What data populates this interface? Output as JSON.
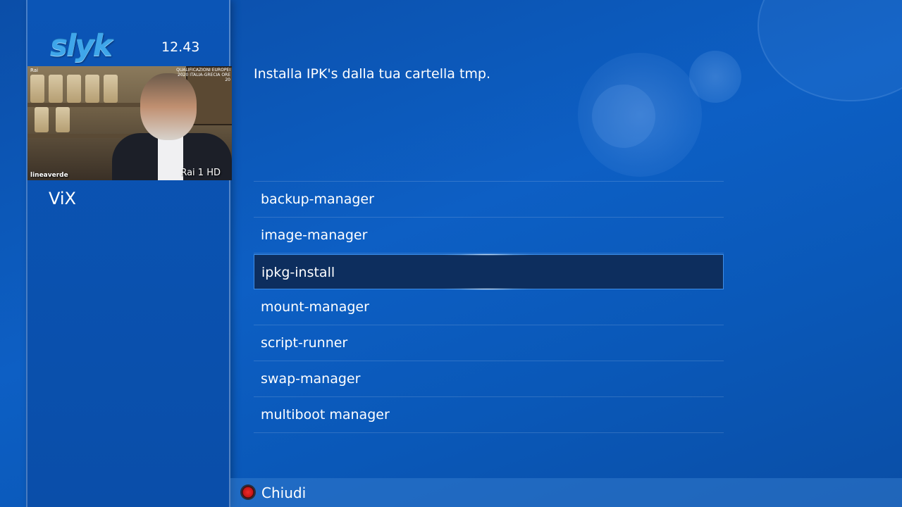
{
  "header": {
    "logo_text": "slyk",
    "clock": "12.43"
  },
  "preview": {
    "channel": "Rai 1 HD",
    "show_logo": "lineaverde",
    "network_tag": "Rai",
    "overlay_text": "QUALIFICAZIONI EUROPEI 2020 ITALIA-GRECIA ORE 20"
  },
  "menu_title": "ViX",
  "description": "Installa IPK's dalla tua cartella tmp.",
  "menu": {
    "items": [
      {
        "label": "backup-manager"
      },
      {
        "label": "image-manager"
      },
      {
        "label": "ipkg-install"
      },
      {
        "label": "mount-manager"
      },
      {
        "label": "script-runner"
      },
      {
        "label": "swap-manager"
      },
      {
        "label": "multiboot manager"
      }
    ],
    "selected_index": 2
  },
  "footer": {
    "red_button_label": "Chiudi"
  },
  "colors": {
    "background": "#0b55b6",
    "selection": "#0d2e5e",
    "red_button": "#e02020"
  }
}
